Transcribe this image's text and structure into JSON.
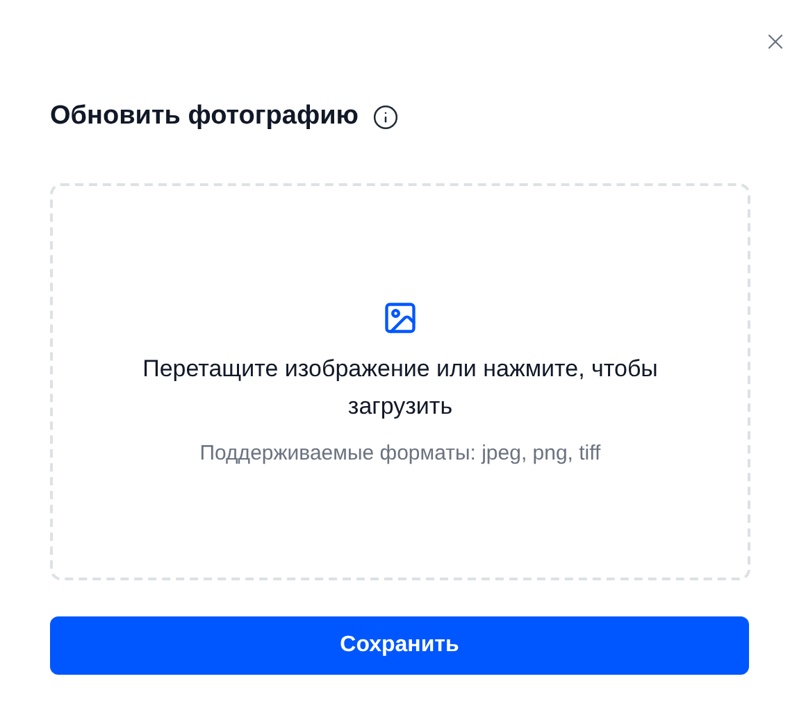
{
  "dialog": {
    "title": "Обновить фотографию"
  },
  "dropzone": {
    "instruction": "Перетащите изображение или нажмите, чтобы загрузить",
    "formats": "Поддерживаемые форматы: jpeg, png, tiff"
  },
  "buttons": [
    {
      "label": "Сохранить"
    }
  ]
}
